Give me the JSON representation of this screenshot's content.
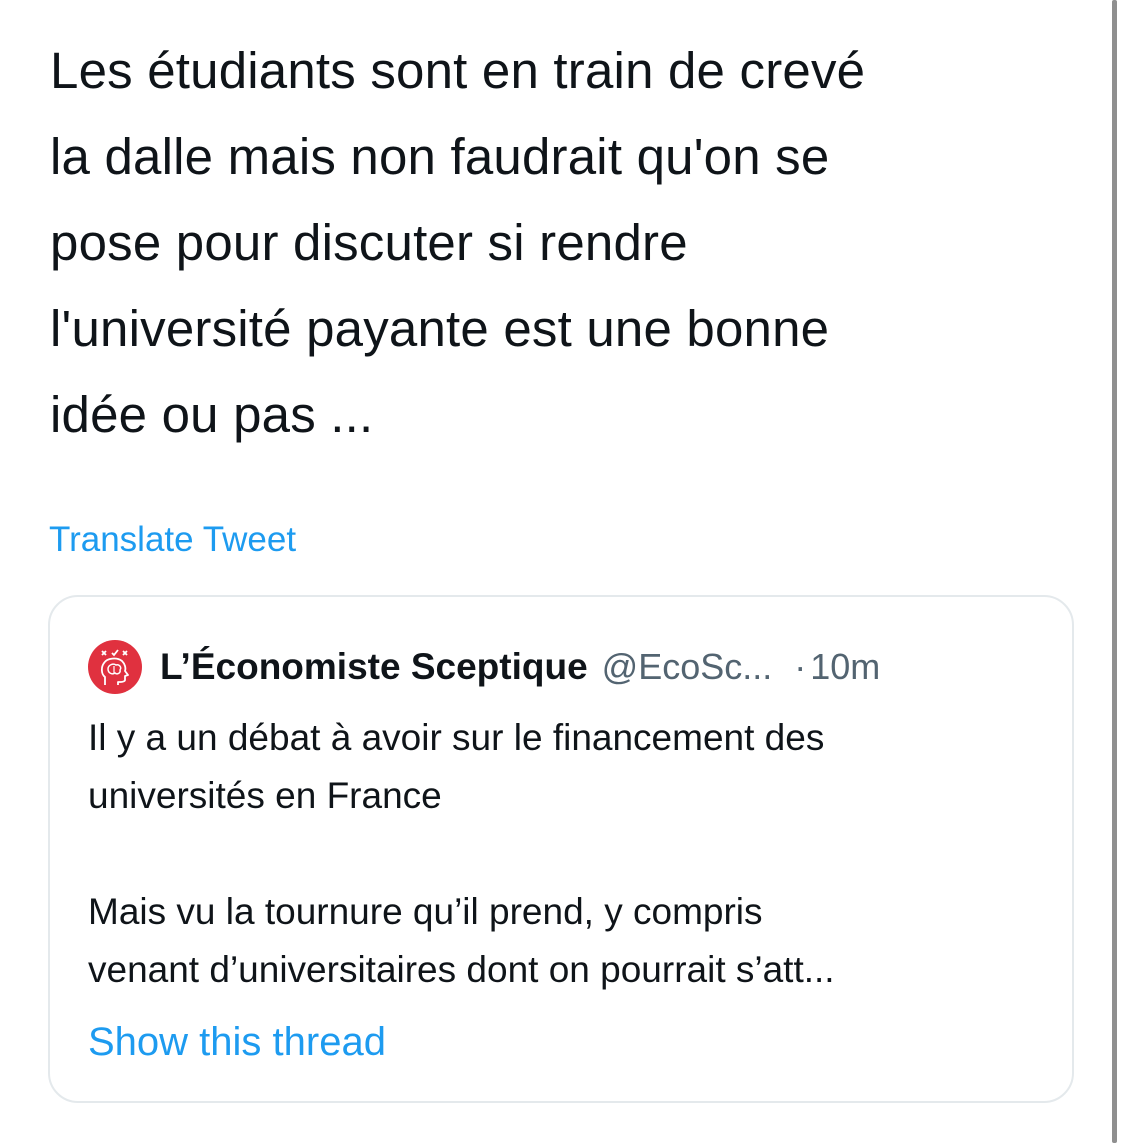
{
  "tweet": {
    "text_lines": [
      "Les étudiants sont en train de crevé",
      "la dalle mais non faudrait qu'on se",
      "pose pour discuter si rendre",
      "l'université payante est une bonne",
      "idée ou pas ..."
    ],
    "translate_label": "Translate Tweet"
  },
  "quoted_tweet": {
    "avatar_icon": "brain-head-icon",
    "author_name": "L’Économiste Sceptique",
    "author_handle": "@EcoSc...",
    "separator": "·",
    "timestamp": "10m",
    "text_lines_1": [
      "Il y a un débat à avoir sur le financement des",
      "universités en France"
    ],
    "text_lines_2": [
      "Mais vu la tournure qu’il prend, y compris",
      "venant d’universitaires dont on pourrait s’att..."
    ],
    "show_thread_label": "Show this thread"
  },
  "colors": {
    "link": "#1d9bf0",
    "text": "#0f1419",
    "secondary": "#536471",
    "avatar_bg": "#e0313f"
  }
}
